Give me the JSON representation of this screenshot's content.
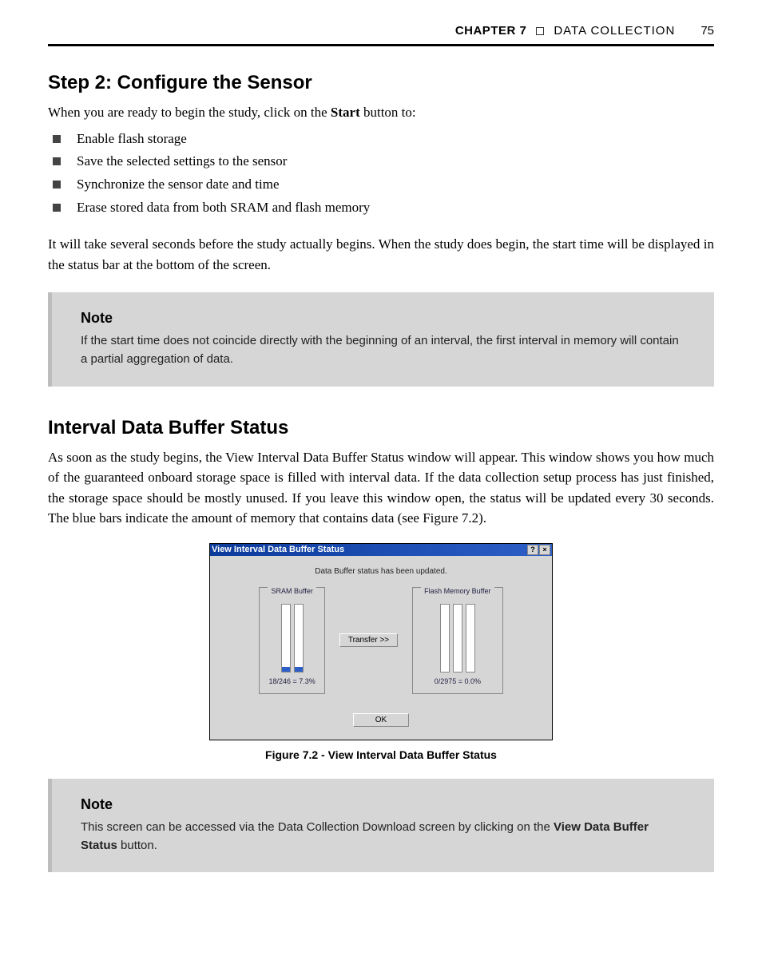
{
  "header": {
    "chapter": "CHAPTER 7",
    "section": "DATA COLLECTION",
    "page": "75"
  },
  "step2": {
    "heading": "Step 2: Configure the Sensor",
    "intro_pre": "When you are ready to begin the study, click on the ",
    "intro_bold": "Start",
    "intro_post": " button to:",
    "bullets": [
      "Enable flash storage",
      "Save the selected settings to the sensor",
      "Synchronize the sensor date and time",
      "Erase stored data from both SRAM and flash memory"
    ],
    "after": "It will take several seconds before the study actually begins. When the study does begin, the start time will be displayed in the status bar at the bottom of the screen."
  },
  "note1": {
    "title": "Note",
    "body": "If the start time does not coincide directly with the beginning of an interval, the first interval in memory will contain a partial aggregation of data."
  },
  "interval": {
    "heading": "Interval Data Buffer Status",
    "body": "As soon as the study begins, the View Interval Data Buffer Status window will appear. This window shows you how much of the guaranteed onboard storage space is filled with interval data. If the data collection setup process has just finished, the storage space should be mostly unused. If you leave this window open, the status will be updated every 30 seconds. The blue bars indicate the amount of memory that contains data (see Figure 7.2)."
  },
  "dialog": {
    "title": "View Interval Data Buffer Status",
    "help_icon": "?",
    "close_icon": "×",
    "status": "Data Buffer status has been updated.",
    "sram_label": "SRAM Buffer",
    "flash_label": "Flash Memory Buffer",
    "transfer": "Transfer >>",
    "sram_text": "18/246 = 7.3%",
    "flash_text": "0/2975 = 0.0%",
    "ok": "OK",
    "sram_fill_pct": 7,
    "flash_fill_pct": 0
  },
  "figure_caption": "Figure 7.2 - View Interval Data Buffer Status",
  "note2": {
    "title": "Note",
    "body_pre": "This screen can be accessed via the Data Collection Download screen by clicking on the ",
    "body_bold": "View Data Buffer Status",
    "body_post": " button."
  }
}
